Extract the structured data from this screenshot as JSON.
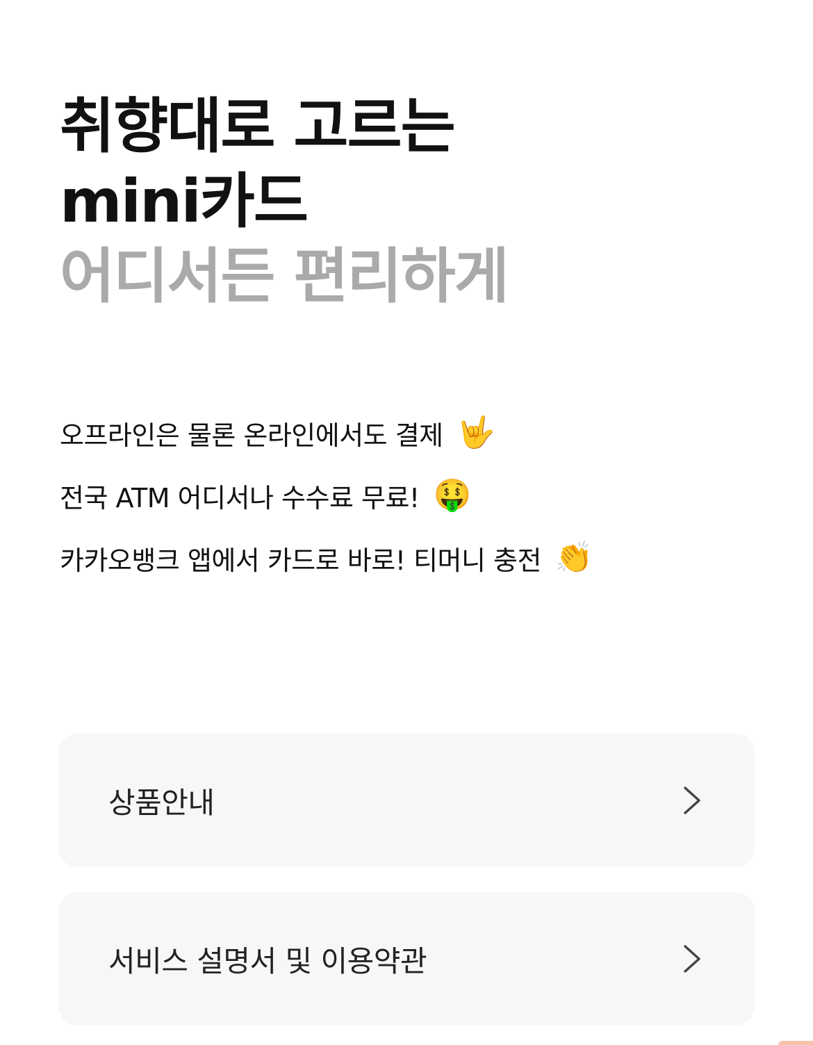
{
  "hero": {
    "line1": "취향대로 고르는",
    "line2": "mini카드",
    "line3": "어디서든 편리하게"
  },
  "features": [
    {
      "text": "오프라인은 물론 온라인에서도 결제",
      "emoji": "🤟",
      "icon": "love-you-gesture-icon"
    },
    {
      "text": "전국 ATM 어디서나 수수료 무료!",
      "emoji": "🤑",
      "icon": "money-mouth-face-icon"
    },
    {
      "text": "카카오뱅크 앱에서 카드로 바로! 티머니 충전",
      "emoji": "👏",
      "icon": "clapping-hands-icon"
    }
  ],
  "menu": [
    {
      "label": "상품안내",
      "icon": "chevron-right-icon"
    },
    {
      "label": "서비스 설명서 및 이용약관",
      "icon": "chevron-right-icon"
    }
  ],
  "colors": {
    "primary_text": "#111111",
    "muted_text": "#aaaaaa",
    "card_bg": "#f7f7f7",
    "chevron": "#444444"
  }
}
